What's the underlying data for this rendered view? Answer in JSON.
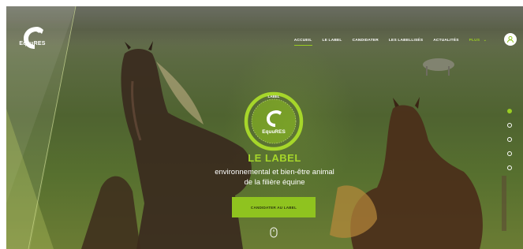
{
  "brand": {
    "name": "EquuRES"
  },
  "nav": {
    "items": [
      {
        "label": "ACCUEIL",
        "active": true
      },
      {
        "label": "LE LABEL",
        "active": false
      },
      {
        "label": "CANDIDATER",
        "active": false
      },
      {
        "label": "LES LABELLISÉS",
        "active": false
      },
      {
        "label": "ACTUALITÉS",
        "active": false
      },
      {
        "label": "PLUS",
        "active": false
      }
    ]
  },
  "hero": {
    "badge_top": "LABEL",
    "badge_name": "EquuRES",
    "title": "LE LABEL",
    "subtitle_line1": "environnemental et bien-être animal",
    "subtitle_line2": "de la filière équine",
    "cta_label": "CANDIDATER AU LABEL"
  },
  "pagination": {
    "count": 5,
    "active_index": 0
  },
  "colors": {
    "accent": "#9acd22",
    "button": "#8fc31f"
  }
}
